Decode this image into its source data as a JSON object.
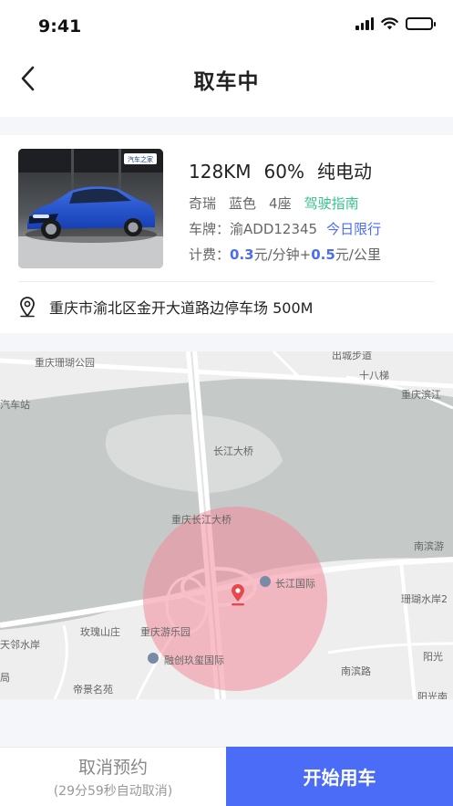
{
  "status_bar": {
    "time": "9:41"
  },
  "nav": {
    "title": "取车中"
  },
  "car": {
    "range": "128KM",
    "battery": "60%",
    "power_type": "纯电动",
    "brand": "奇瑞",
    "color": "蓝色",
    "seats": "4座",
    "guide_link": "驾驶指南",
    "plate_label": "车牌：",
    "plate": "渝ADD12345",
    "restriction": "今日限行",
    "fee_label": "计费：",
    "fee_per_min_value": "0.3",
    "fee_per_min_unit": "元/分钟+",
    "fee_per_km_value": "0.5",
    "fee_per_km_unit": "元/公里",
    "badge_text": "汽车之家"
  },
  "location": {
    "address": "重庆市渝北区金开大道路边停车场 500M"
  },
  "map": {
    "labels": {
      "park": "重庆珊瑚公园",
      "gate": "出城步道",
      "shibati": "十八梯",
      "riverside": "重庆滨江",
      "bus": "汽车站",
      "bridge": "长江大桥",
      "bridge_road": "重庆长江大桥",
      "nanbin": "南滨游",
      "international": "长江国际",
      "coral": "珊瑚水岸2",
      "rose": "玫瑰山庄",
      "amusement": "重庆游乐园",
      "tianlin": "天邻水岸",
      "ju": "局",
      "rongchuang": "融创玖玺国际",
      "yang": "阳光",
      "nanbin_road": "南滨路",
      "dijing": "帝景名苑",
      "yang2": "阳光南"
    }
  },
  "bottom": {
    "cancel_label": "取消预约",
    "cancel_countdown": "(29分59秒自动取消)",
    "start_label": "开始用车"
  },
  "colors": {
    "accent": "#4a6cf7",
    "green": "#34c38f",
    "pin": "#e5484d"
  },
  "icons": [
    "signal-icon",
    "wifi-icon",
    "battery-icon",
    "back-arrow-icon",
    "location-pin-icon",
    "map-pin-icon",
    "poi-icon"
  ]
}
